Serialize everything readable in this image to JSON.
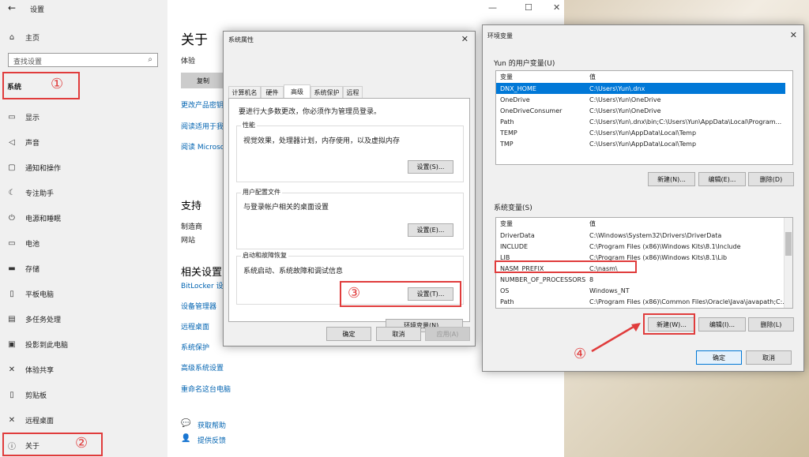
{
  "settings": {
    "title": "设置",
    "home": "主页",
    "search_placeholder": "查找设置",
    "category": "系统",
    "nav": [
      "显示",
      "声音",
      "通知和操作",
      "专注助手",
      "电源和睡眠",
      "电池",
      "存储",
      "平板电脑",
      "多任务处理",
      "投影到此电脑",
      "体验共享",
      "剪贴板",
      "远程桌面",
      "关于"
    ],
    "nav_icons": [
      "monitor-icon",
      "speaker-icon",
      "notification-icon",
      "moon-icon",
      "power-icon",
      "battery-icon",
      "storage-icon",
      "tablet-icon",
      "multitask-icon",
      "project-icon",
      "share-icon",
      "clipboard-icon",
      "remote-desktop-icon",
      "info-icon"
    ],
    "main": {
      "title": "关于",
      "experience": "体验",
      "copy_button": "复制",
      "links1": [
        "更改产品密钥",
        "阅读适用于我",
        "阅读 Microso"
      ],
      "support_title": "支持",
      "support_rows": [
        "制造商",
        "网站"
      ],
      "related_title": "相关设置",
      "related_links": [
        "BitLocker 设置",
        "设备管理器",
        "远程桌面",
        "系统保护",
        "高级系统设置",
        "重命名这台电脑"
      ],
      "help": "获取帮助",
      "feedback": "提供反馈"
    }
  },
  "sysprops": {
    "title": "系统属性",
    "tabs": [
      "计算机名",
      "硬件",
      "高级",
      "系统保护",
      "远程"
    ],
    "admin_note": "要进行大多数更改，你必须作为管理员登录。",
    "perf_label": "性能",
    "perf_desc": "视觉效果，处理器计划，内存使用，以及虚拟内存",
    "perf_btn": "设置(S)...",
    "profile_label": "用户配置文件",
    "profile_desc": "与登录帐户相关的桌面设置",
    "profile_btn": "设置(E)...",
    "startup_label": "启动和故障恢复",
    "startup_desc": "系统启动、系统故障和调试信息",
    "startup_btn": "设置(T)...",
    "env_btn": "环境变量(N)...",
    "ok": "确定",
    "cancel": "取消",
    "apply": "应用(A)"
  },
  "envvars": {
    "title": "环境变量",
    "user_label": "Yun 的用户变量(U)",
    "col_var": "变量",
    "col_val": "值",
    "user_rows": [
      [
        "DNX_HOME",
        "C:\\Users\\Yun\\.dnx"
      ],
      [
        "OneDrive",
        "C:\\Users\\Yun\\OneDrive"
      ],
      [
        "OneDriveConsumer",
        "C:\\Users\\Yun\\OneDrive"
      ],
      [
        "Path",
        "C:\\Users\\Yun\\.dnx\\bin;C:\\Users\\Yun\\AppData\\Local\\Program..."
      ],
      [
        "TEMP",
        "C:\\Users\\Yun\\AppData\\Local\\Temp"
      ],
      [
        "TMP",
        "C:\\Users\\Yun\\AppData\\Local\\Temp"
      ]
    ],
    "user_new": "新建(N)...",
    "user_edit": "编辑(E)...",
    "user_delete": "删除(D)",
    "sys_label": "系统变量(S)",
    "sys_rows": [
      [
        "DriverData",
        "C:\\Windows\\System32\\Drivers\\DriverData"
      ],
      [
        "INCLUDE",
        "C:\\Program Files (x86)\\Windows Kits\\8.1\\Include"
      ],
      [
        "LIB",
        "C:\\Program Files (x86)\\Windows Kits\\8.1\\Lib"
      ],
      [
        "NASM_PREFIX",
        "C:\\nasm\\"
      ],
      [
        "NUMBER_OF_PROCESSORS",
        "8"
      ],
      [
        "OS",
        "Windows_NT"
      ],
      [
        "Path",
        "C:\\Program Files (x86)\\Common Files\\Oracle\\Java\\javapath;C:..."
      ]
    ],
    "sys_new": "新建(W)...",
    "sys_edit": "编辑(I)...",
    "sys_delete": "删除(L)",
    "ok": "确定",
    "cancel": "取消"
  },
  "annotations": {
    "c1": "①",
    "c2": "②",
    "c3": "③",
    "c4": "④"
  },
  "colors": {
    "accent": "#0078d7",
    "annotation": "#e03c3c",
    "link": "#0063b1"
  }
}
